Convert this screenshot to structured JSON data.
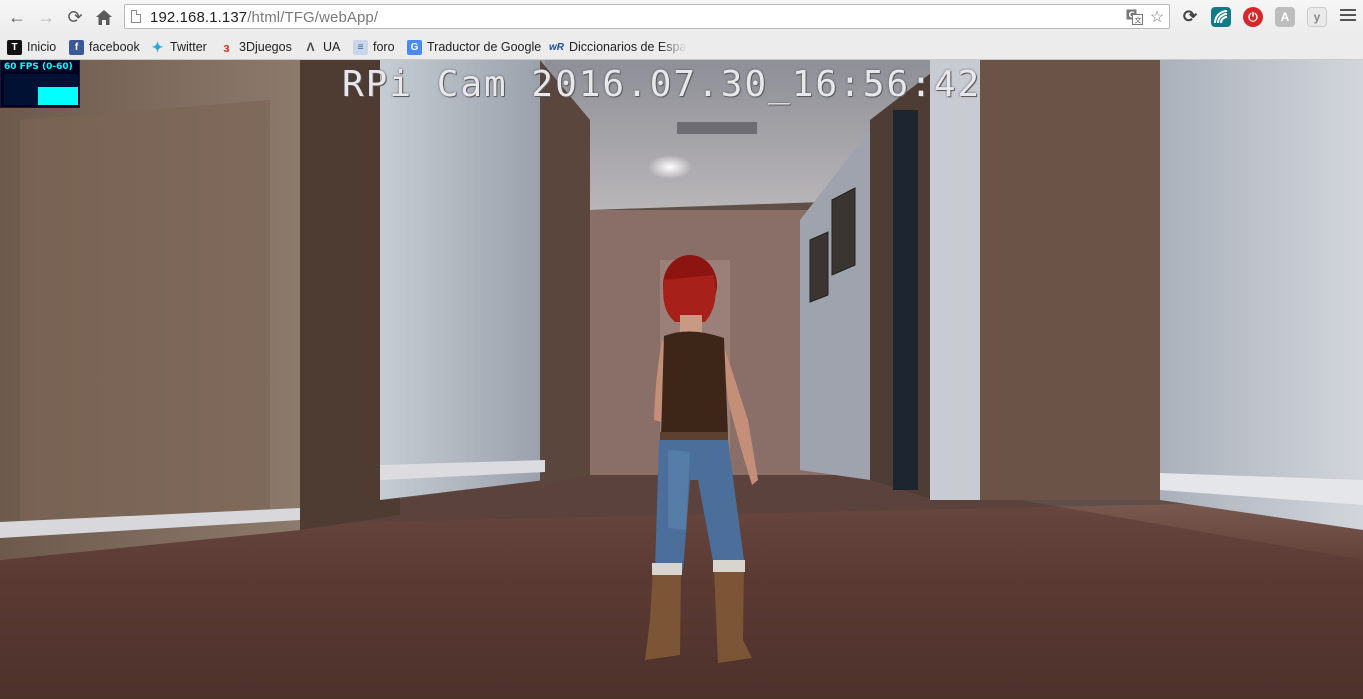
{
  "browser": {
    "url_host": "192.168.1.137",
    "url_path": "/html/TFG/webApp/",
    "nav": {
      "back_icon": "back-arrow-icon",
      "forward_icon": "forward-arrow-icon",
      "reload_icon": "reload-icon",
      "home_icon": "home-icon"
    },
    "extensions": [
      "translate-icon",
      "star-icon",
      "sync-icon",
      "cast-icon",
      "power-icon",
      "angular-icon",
      "extension-icon"
    ]
  },
  "bookmarks": [
    {
      "label": "Inicio",
      "icon": "inicio-icon"
    },
    {
      "label": "facebook",
      "icon": "facebook-icon"
    },
    {
      "label": "Twitter",
      "icon": "twitter-icon"
    },
    {
      "label": "3Djuegos",
      "icon": "3djuegos-icon"
    },
    {
      "label": "UA",
      "icon": "ua-icon"
    },
    {
      "label": "foro",
      "icon": "foro-icon"
    },
    {
      "label": "Traductor de Google",
      "icon": "google-translate-icon"
    },
    {
      "label": "Diccionarios de Españ",
      "icon": "wordreference-icon"
    }
  ],
  "stats": {
    "fps_label": "60 FPS (0-60)",
    "fps_fraction": 1.0,
    "colors": {
      "text": "#00ffff",
      "bg": "#000022"
    }
  },
  "camera": {
    "overlay_text": "RPi Cam 2016.07.30_16:56:42"
  }
}
